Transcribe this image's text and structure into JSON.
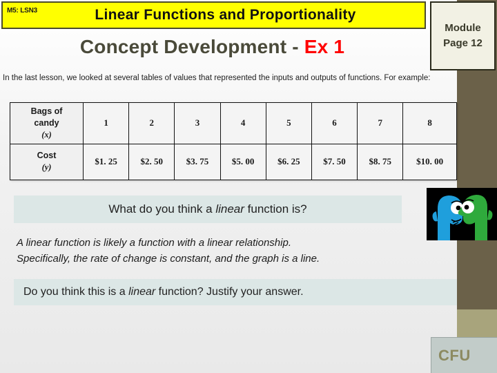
{
  "header": {
    "lesson_tag": "M5: LSN3",
    "title": "Linear Functions and Proportionality",
    "subtitle_main": "Concept Development - ",
    "subtitle_accent": "Ex 1",
    "module_label": "Module",
    "page_label": "Page 12"
  },
  "intro": {
    "text": "In the last lesson, we looked at several tables of values that represented the inputs and outputs of functions.  For example:"
  },
  "table": {
    "row1_header_line1": "Bags of",
    "row1_header_line2": "candy",
    "row1_header_var": "(x)",
    "row2_header_line1": "Cost",
    "row2_header_var": "(y)",
    "x_values": [
      "1",
      "2",
      "3",
      "4",
      "5",
      "6",
      "7",
      "8"
    ],
    "y_values": [
      "$1. 25",
      "$2. 50",
      "$3. 75",
      "$5. 00",
      "$6. 25",
      "$7. 50",
      "$8. 75",
      "$10. 00"
    ]
  },
  "question1": {
    "part_a": "What do you think a ",
    "emphasis": "linear",
    "part_b": " function is?"
  },
  "answer": {
    "line1": "A linear function is likely a function with a linear relationship.",
    "line2": "Specifically, the rate of change is constant, and the graph is a line."
  },
  "question2": {
    "part_a": "Do you think this is a ",
    "emphasis": "linear",
    "part_b": " function?  Justify your answer."
  },
  "cfu": {
    "label": "CFU"
  },
  "colors": {
    "title_bar": "#ffff00",
    "accent_red": "#ff0000",
    "banner": "#dce7e6",
    "sidebar_olive": "#6b6149",
    "sidebar_tan": "#a8a47c",
    "cfu_bg": "#c2ccc9",
    "cfu_text": "#8c8a60"
  },
  "illustration": {
    "name": "two-talking-characters",
    "figure_left_color": "#1f9fdc",
    "figure_right_color": "#2faa3c",
    "background": "#000000"
  }
}
